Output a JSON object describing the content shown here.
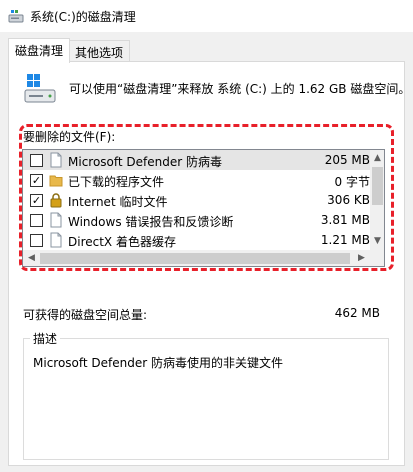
{
  "window": {
    "title": "系统(C:)的磁盘清理"
  },
  "tabs": [
    {
      "label": "磁盘清理"
    },
    {
      "label": "其他选项"
    }
  ],
  "intro": {
    "text": "可以使用“磁盘清理”来释放 系统 (C:) 上的 1.62 GB 磁盘空间。"
  },
  "files_label": "要删除的文件(F):",
  "file_items": [
    {
      "name": "Microsoft Defender 防病毒",
      "size": "205 MB",
      "checked": false,
      "icon": "file-icon",
      "selected": true
    },
    {
      "name": "已下载的程序文件",
      "size": "0 字节",
      "checked": true,
      "icon": "folder-icon",
      "selected": false
    },
    {
      "name": "Internet 临时文件",
      "size": "306 KB",
      "checked": true,
      "icon": "lock-icon",
      "selected": false
    },
    {
      "name": "Windows 错误报告和反馈诊断",
      "size": "3.81 MB",
      "checked": false,
      "icon": "file-icon",
      "selected": false
    },
    {
      "name": "DirectX 着色器缓存",
      "size": "1.21 MB",
      "checked": false,
      "icon": "file-icon",
      "selected": false
    }
  ],
  "space": {
    "label": "可获得的磁盘空间总量:",
    "value": "462 MB"
  },
  "description": {
    "legend": "描述",
    "text": "Microsoft Defender 防病毒使用的非关键文件"
  },
  "colors": {
    "highlight": "#e8202a",
    "folder": "#e8b84a",
    "lock": "#d4a017"
  }
}
